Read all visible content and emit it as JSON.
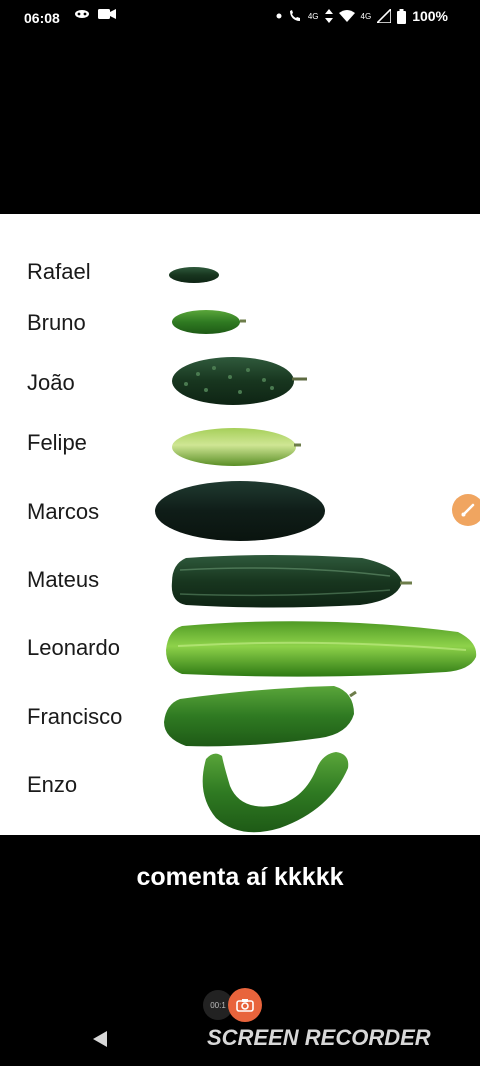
{
  "status_bar": {
    "time": "06:08",
    "network_badge_1": "4G",
    "network_badge_2": "4G",
    "battery_text": "100%"
  },
  "names": [
    {
      "label": "Rafael"
    },
    {
      "label": "Bruno"
    },
    {
      "label": "João"
    },
    {
      "label": "Felipe"
    },
    {
      "label": "Marcos"
    },
    {
      "label": "Mateus"
    },
    {
      "label": "Leonardo"
    },
    {
      "label": "Francisco"
    },
    {
      "label": "Enzo"
    }
  ],
  "caption": "comenta aí kkkkk",
  "recorder": {
    "timer_text": "00:1",
    "watermark": "SCREEN RECORDER"
  }
}
